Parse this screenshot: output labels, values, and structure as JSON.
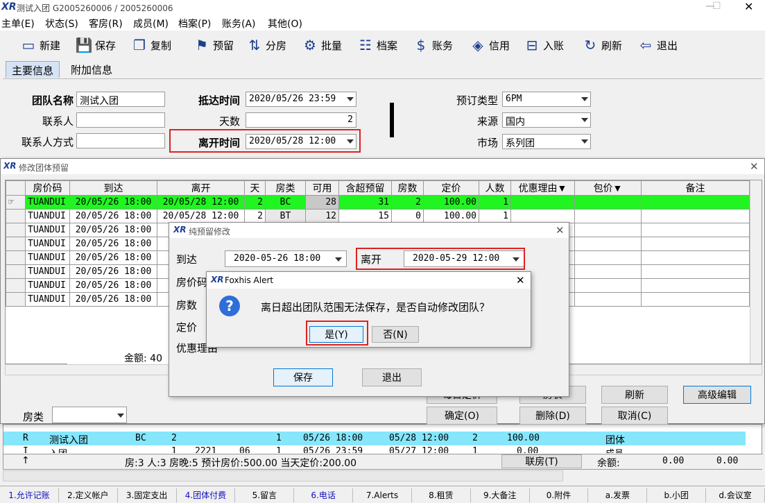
{
  "titlebar": {
    "logo": "XR",
    "title": "测试入团  G2005260006 / 2005260006"
  },
  "menu": [
    "主单(E)",
    "状态(S)",
    "客房(R)",
    "成员(M)",
    "档案(P)",
    "账务(A)",
    "其他(O)"
  ],
  "toolbar": [
    {
      "label": "新建",
      "icon": "new-icon",
      "glyph": "▭"
    },
    {
      "label": "保存",
      "icon": "save-icon",
      "glyph": "💾"
    },
    {
      "label": "复制",
      "icon": "copy-icon",
      "glyph": "❐"
    },
    {
      "label": "预留",
      "icon": "reserve-icon",
      "glyph": "⚑"
    },
    {
      "label": "分房",
      "icon": "assign-room-icon",
      "glyph": "⇅"
    },
    {
      "label": "批量",
      "icon": "batch-icon",
      "glyph": "⚙"
    },
    {
      "label": "档案",
      "icon": "profile-icon",
      "glyph": "☷"
    },
    {
      "label": "账务",
      "icon": "accounts-icon",
      "glyph": "$"
    },
    {
      "label": "信用",
      "icon": "credit-icon",
      "glyph": "◈"
    },
    {
      "label": "入账",
      "icon": "post-icon",
      "glyph": "⊟"
    },
    {
      "label": "刷新",
      "icon": "refresh-icon",
      "glyph": "↻"
    },
    {
      "label": "退出",
      "icon": "exit-icon",
      "glyph": "⇦"
    }
  ],
  "tabs": [
    "主要信息",
    "附加信息"
  ],
  "form": {
    "group_name_label": "团队名称",
    "group_name": "测试入团",
    "contact_label": "联系人",
    "contact": "",
    "contact_method_label": "联系人方式",
    "contact_method": "",
    "arrival_label": "抵达时间",
    "arrival": "2020/05/26 23:59",
    "days_label": "天数",
    "days": "2",
    "departure_label": "离开时间",
    "departure": "2020/05/28 12:00",
    "booking_type_label": "预订类型",
    "booking_type": "6PM",
    "source_label": "来源",
    "source": "国内",
    "market_label": "市场",
    "market": "系列团"
  },
  "block_window": {
    "logo": "XR",
    "title": "修改团体预留",
    "headers": [
      "房价码",
      "到达",
      "离开",
      "天",
      "房类",
      "可用",
      "含超预留",
      "房数",
      "定价",
      "人数",
      "优惠理由▼",
      "包价▼",
      "备注"
    ],
    "rows": [
      [
        "TUANDUI",
        "20/05/26 18:00",
        "20/05/28 12:00",
        "2",
        "BC",
        "28",
        "31",
        "2",
        "100.00",
        "1",
        "",
        "",
        ""
      ],
      [
        "TUANDUI",
        "20/05/26 18:00",
        "20/05/28 12:00",
        "2",
        "BT",
        "12",
        "15",
        "0",
        "100.00",
        "1",
        "",
        "",
        ""
      ],
      [
        "TUANDUI",
        "20/05/26 18:00",
        "20/05",
        "",
        "",
        "",
        "",
        "",
        "",
        "",
        "",
        "",
        ""
      ],
      [
        "TUANDUI",
        "20/05/26 18:00",
        "20/05",
        "",
        "",
        "",
        "",
        "",
        "",
        "",
        "",
        "",
        ""
      ],
      [
        "TUANDUI",
        "20/05/26 18:00",
        "20/05",
        "",
        "",
        "",
        "",
        "",
        "",
        "",
        "",
        "",
        ""
      ],
      [
        "TUANDUI",
        "20/05/26 18:00",
        "20/05",
        "",
        "",
        "",
        "",
        "",
        "",
        "",
        "",
        "",
        ""
      ],
      [
        "TUANDUI",
        "20/05/26 18:00",
        "20/05",
        "",
        "",
        "",
        "",
        "",
        "",
        "",
        "",
        "",
        ""
      ],
      [
        "TUANDUI",
        "20/05/26 18:00",
        "20/05",
        "",
        "",
        "",
        "",
        "",
        "",
        "",
        "",
        "",
        ""
      ]
    ],
    "total_label": "金额: 40",
    "roomtype_label": "房类",
    "btn_daily": "每日定价",
    "btn_roomtable": "房表",
    "btn_refresh": "刷新",
    "btn_advanced": "高级编辑",
    "btn_ok": "确定(O)",
    "btn_delete": "删除(D)",
    "btn_cancel": "取消(C)"
  },
  "edit_window": {
    "logo": "XR",
    "title": "纯预留修改",
    "arrival_label": "到达",
    "arrival": "2020-05-26 18:00",
    "departure_label": "离开",
    "departure": "2020-05-29 12:00",
    "ratecode_label": "房价码",
    "rooms_label": "房数",
    "price_label": "定价",
    "discount_label": "优惠理由",
    "save": "保存",
    "exit": "退出"
  },
  "alert": {
    "logo": "XR",
    "title": "Foxhis Alert",
    "message": "离日超出团队范围无法保存，是否自动修改团队？",
    "yes": "是(Y)",
    "no": "否(N)"
  },
  "bottom": {
    "row1": [
      "R",
      "测试入团",
      "BC",
      "2",
      "",
      "1",
      "05/26 18:00",
      "05/28 12:00",
      "2",
      "100.00",
      "",
      "团体"
    ],
    "row2": [
      "I",
      "入团",
      "",
      "1",
      "2221",
      "06",
      "1",
      "05/26 23:59",
      "05/27 12:00",
      "1",
      "0.00",
      "成员"
    ],
    "summary": "房:3  人:3  房晚:5  预计房价:500.00  当天定价:200.00",
    "join_btn": "联房(T)",
    "balance_label": "余额:",
    "bal1": "0.00",
    "bal2": "0.00"
  },
  "fkeys": [
    "1.允许记账",
    "2.定义帐户",
    "3.固定支出",
    "4.团体付费",
    "5.留言",
    "6.电话",
    "7.Alerts",
    "8.租赁",
    "9.大备注",
    "0.附件",
    "a.发票",
    "b.小团",
    "d.会议室"
  ]
}
